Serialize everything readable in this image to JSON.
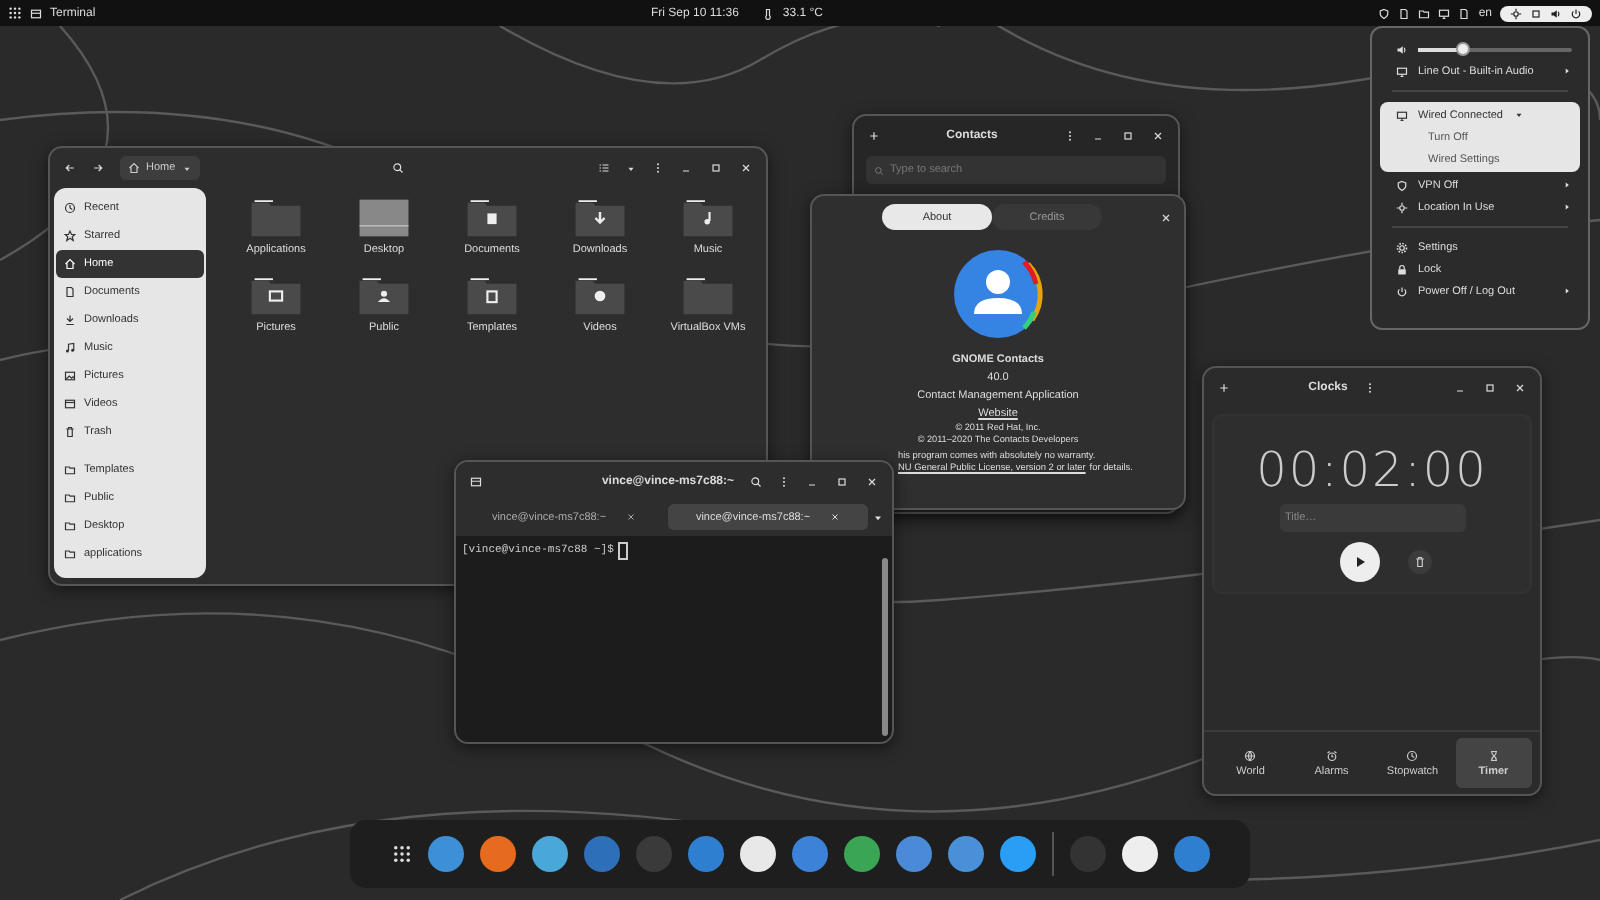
{
  "top_bar": {
    "app_menu": "Terminal",
    "clock": "Fri Sep 10  11:36",
    "temperature": "33.1 °C",
    "keyboard_layout": "en"
  },
  "files": {
    "path": "Home",
    "places": [
      {
        "label": "Recent",
        "selected": false
      },
      {
        "label": "Starred",
        "selected": false
      },
      {
        "label": "Home",
        "selected": true
      },
      {
        "label": "Documents",
        "selected": false
      },
      {
        "label": "Downloads",
        "selected": false
      },
      {
        "label": "Music",
        "selected": false
      },
      {
        "label": "Pictures",
        "selected": false
      },
      {
        "label": "Videos",
        "selected": false
      },
      {
        "label": "Trash",
        "selected": false
      }
    ],
    "bookmarks": [
      {
        "label": "Templates",
        "selected": false
      },
      {
        "label": "Public",
        "selected": false
      },
      {
        "label": "Desktop",
        "selected": false
      },
      {
        "label": "applications",
        "selected": false
      }
    ],
    "folders": [
      "Applications",
      "Desktop",
      "Documents",
      "Downloads",
      "Music",
      "Pictures",
      "Public",
      "Templates",
      "Videos",
      "VirtualBox VMs"
    ]
  },
  "contacts": {
    "title": "Contacts",
    "search": {
      "placeholder": "Type to search"
    }
  },
  "about_dialog": {
    "tabs": [
      {
        "label": "About",
        "selected": true
      },
      {
        "label": "Credits",
        "selected": false
      }
    ],
    "app_name": "GNOME Contacts",
    "version": "40.0",
    "description": "Contact Management Application",
    "website": "Website",
    "copyright": [
      "© 2011 Red Hat, Inc.",
      "© 2011–2020 The Contacts Developers"
    ],
    "license_line_1": "his program comes with absolutely no warranty.",
    "license_line_2": {
      "link": "NU General Public License, version 2 or later",
      "rest": "for details."
    }
  },
  "terminal": {
    "title": "vince@vince-ms7c88:~",
    "tabs": [
      {
        "label": "vince@vince-ms7c88:~",
        "selected": false
      },
      {
        "label": "vince@vince-ms7c88:~",
        "selected": true
      }
    ],
    "prompt": "[vince@vince-ms7c88 ~]$"
  },
  "clocks": {
    "title": "Clocks",
    "time": "00:02:00",
    "title_field": {
      "placeholder": "Title…"
    },
    "tabs": [
      {
        "label": "World",
        "selected": false
      },
      {
        "label": "Alarms",
        "selected": false
      },
      {
        "label": "Stopwatch",
        "selected": false
      },
      {
        "label": "Timer",
        "selected": true
      }
    ]
  },
  "system_menu": {
    "volume": {
      "level": 0.3
    },
    "output": {
      "label": "Line Out - Built-in Audio",
      "submenu": true
    },
    "network": {
      "label": "Wired Connected",
      "expanded": true,
      "items": [
        "Turn Off",
        "Wired Settings"
      ]
    },
    "status_rows": [
      {
        "label": "VPN Off",
        "submenu": true
      },
      {
        "label": "Location In Use",
        "submenu": true
      }
    ],
    "actions": [
      {
        "label": "Settings",
        "submenu": false
      },
      {
        "label": "Lock",
        "submenu": false
      },
      {
        "label": "Power Off / Log Out",
        "submenu": true
      }
    ]
  },
  "dock": {
    "items": [
      {
        "color": "#3d8fd6"
      },
      {
        "color": "#e66b1f"
      },
      {
        "color": "#4aa8d8"
      },
      {
        "color": "#2e6fba"
      },
      {
        "color": "#3a3a3a"
      },
      {
        "color": "#2f7fd1"
      },
      {
        "color": "#e8e8e8"
      },
      {
        "color": "#3b82d8"
      },
      {
        "color": "#3aa655"
      },
      {
        "color": "#4a8ad6"
      },
      {
        "color": "#4a90d9"
      },
      {
        "color": "#2a9df4"
      },
      {
        "color": "#333333"
      },
      {
        "color": "#eeeeee"
      },
      {
        "color": "#2f7fd1"
      }
    ]
  }
}
